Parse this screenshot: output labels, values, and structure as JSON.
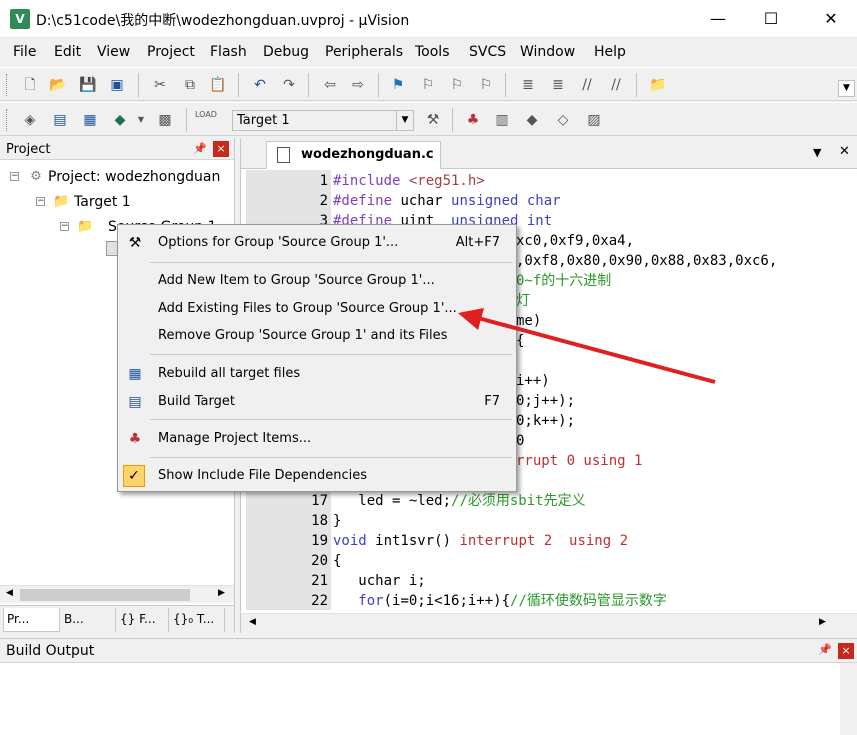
{
  "window": {
    "title": "D:\\c51code\\我的中断\\wodezhongduan.uvproj - µVision",
    "app_icon": "µvision-logo",
    "minimize_glyph": "—",
    "maximize_glyph": "☐",
    "close_glyph": "✕"
  },
  "menubar": [
    "File",
    "Edit",
    "View",
    "Project",
    "Flash",
    "Debug",
    "Peripherals",
    "Tools",
    "SVCS",
    "Window",
    "Help"
  ],
  "toolbar2": {
    "target_value": "Target 1"
  },
  "project_panel": {
    "title": "Project",
    "tree": {
      "project": "Project: wodezhongduan",
      "target": "Target 1",
      "group": "Source Group 1"
    },
    "tabs": [
      "Pr...",
      "B...",
      "{} F...",
      "{}₀ T..."
    ]
  },
  "editor": {
    "tab_label": "wodezhongduan.c",
    "lines": [
      {
        "n": "1",
        "t": "#include <reg51.h>"
      },
      {
        "n": "2",
        "t": "#define uchar unsigned char"
      },
      {
        "n": "3",
        "t": "#define uint  unsigned int"
      },
      {
        "n": "17",
        "t": "   led = ~led;//必须用sbit先定义"
      },
      {
        "n": "18",
        "t": "}"
      },
      {
        "n": "19",
        "t": "void int1svr() interrupt 2  using 2"
      },
      {
        "n": "20",
        "t": "{"
      },
      {
        "n": "21",
        "t": "   uchar i;"
      },
      {
        "n": "22",
        "t": "   for(i=0;i<16;i++){//循环使数码管显示数字"
      }
    ],
    "partial_visible": [
      "xc0,0xf9,0xa4,",
      ",0xf8,0x80,0x90,0x88,0x83,0xc6,",
      "0~f的十六进制",
      "灯",
      "me)",
      "{",
      "i++)",
      "0;j++);",
      "0;k++);",
      "0",
      "rrupt 0 using 1"
    ]
  },
  "context_menu": {
    "items": [
      {
        "label": "Options for Group 'Source Group 1'...",
        "shortcut": "Alt+F7",
        "icon": "magic-wand-icon"
      },
      {
        "label": "Add New  Item to Group 'Source Group 1'...",
        "shortcut": "",
        "icon": ""
      },
      {
        "label": "Add Existing Files to Group 'Source Group 1'...",
        "shortcut": "",
        "icon": ""
      },
      {
        "label": "Remove Group 'Source Group 1' and its Files",
        "shortcut": "",
        "icon": ""
      },
      {
        "label": "Rebuild all target files",
        "shortcut": "",
        "icon": "rebuild-icon"
      },
      {
        "label": "Build Target",
        "shortcut": "F7",
        "icon": "build-icon"
      },
      {
        "label": "Manage Project Items...",
        "shortcut": "",
        "icon": "manage-items-icon"
      },
      {
        "label": "Show Include File Dependencies",
        "shortcut": "",
        "icon": "check-icon"
      }
    ]
  },
  "build_output": {
    "title": "Build Output"
  },
  "colors": {
    "annotation_arrow": "#e02020",
    "close_button": "#c42b1c",
    "check_bg": "#ffd26b"
  }
}
